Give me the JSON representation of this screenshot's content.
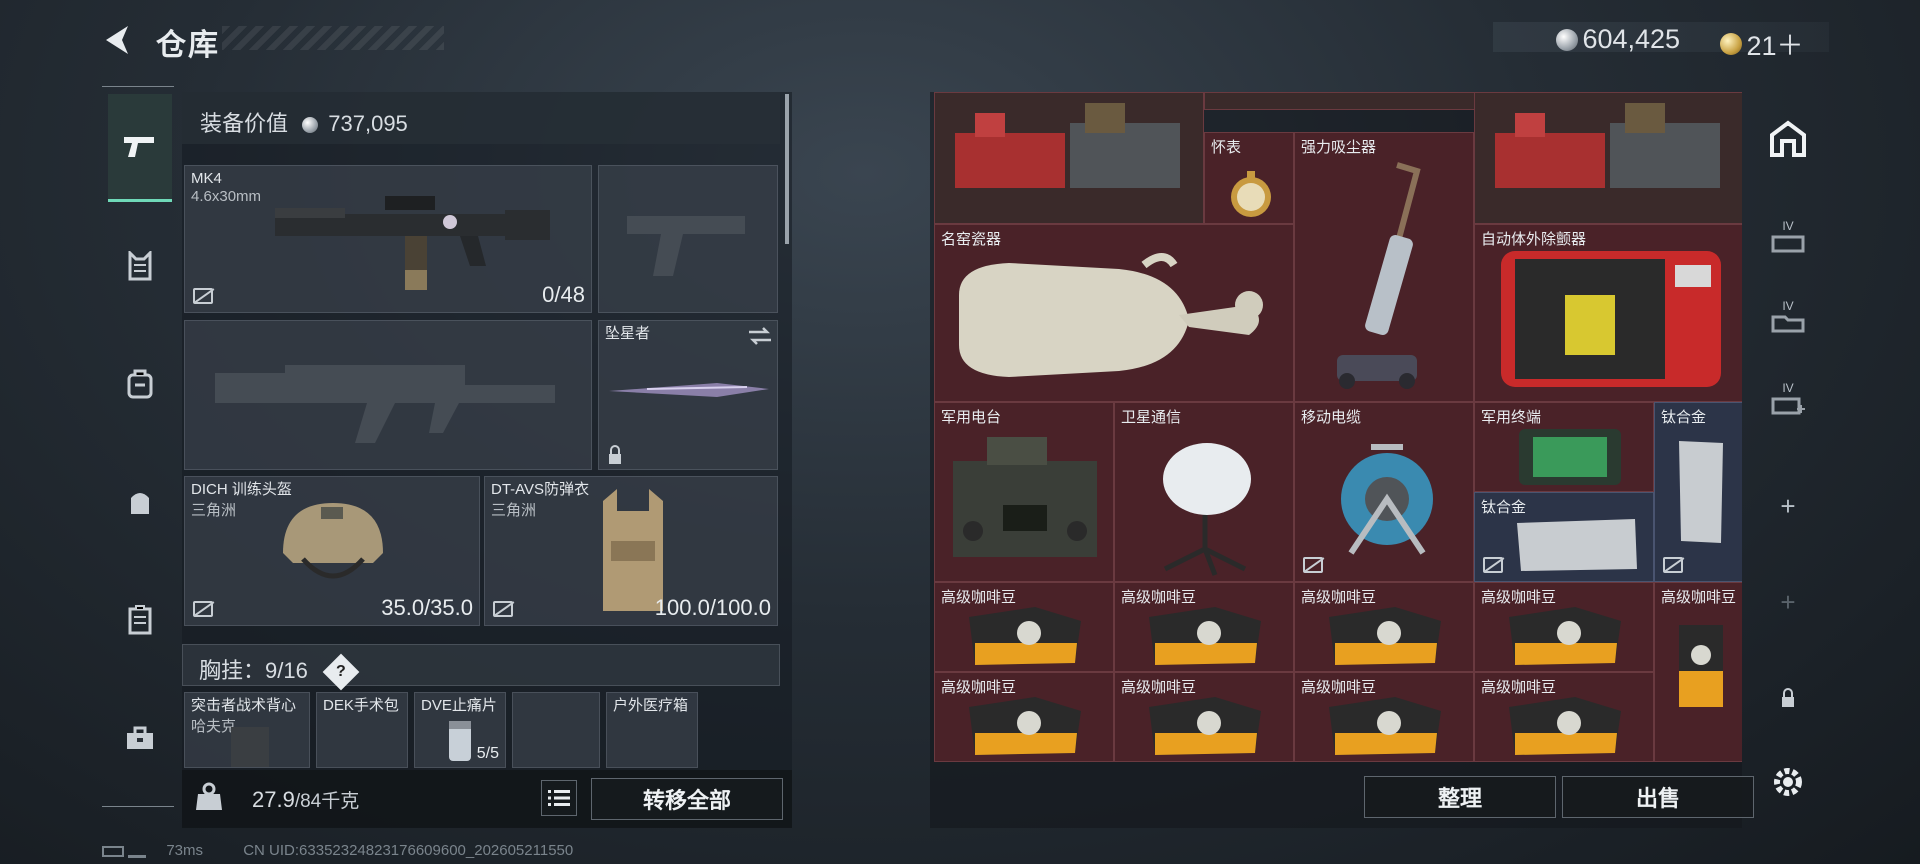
{
  "header": {
    "title": "仓库"
  },
  "currency": {
    "silver": "604,425",
    "gold": "21＋"
  },
  "equipment": {
    "value_label": "装备价值",
    "value": "737,095",
    "primary": {
      "name": "MK4",
      "caliber": "4.6x30mm",
      "ammo": "0/48"
    },
    "melee": {
      "name": "坠星者"
    },
    "helmet": {
      "name": "DICH 训练头盔",
      "sub": "三角洲",
      "durability": "35.0/35.0"
    },
    "armor": {
      "name": "DT-AVS防弹衣",
      "sub": "三角洲",
      "durability": "100.0/100.0"
    },
    "chest_label": "胸挂：",
    "chest_count": "9/16",
    "chest_help": "?",
    "chest_items": [
      {
        "name": "突击者战术背心",
        "sub": "哈夫克"
      },
      {
        "name": "DEK手术包"
      },
      {
        "name": "DVE止痛片",
        "count": "5/5"
      },
      {
        "name": ""
      },
      {
        "name": "户外医疗箱"
      }
    ]
  },
  "footer": {
    "weight_current": "27.9",
    "weight_max": "/84千克",
    "transfer_all": "转移全部"
  },
  "storage": {
    "items": [
      {
        "label": "怀表"
      },
      {
        "label": "强力吸尘器"
      },
      {
        "label": "名窑瓷器"
      },
      {
        "label": "自动体外除颤器"
      },
      {
        "label": "军用电台"
      },
      {
        "label": "卫星通信"
      },
      {
        "label": "移动电缆"
      },
      {
        "label": "军用终端"
      },
      {
        "label": "钛合金"
      },
      {
        "label": "钛合金"
      },
      {
        "label": "高级咖啡豆"
      }
    ],
    "sort_button": "整理",
    "sell_button": "出售"
  },
  "right_sidebar": {
    "tiers": [
      "IV",
      "IV",
      "IV"
    ],
    "plus": "+"
  },
  "status_bar": {
    "ping": "73ms",
    "uid": "CN UID:63352324823176609600_202605211550"
  },
  "colors": {
    "accent": "#6fd9b8",
    "cell_red": "#4a2228",
    "cell_blue": "#2c3448"
  }
}
